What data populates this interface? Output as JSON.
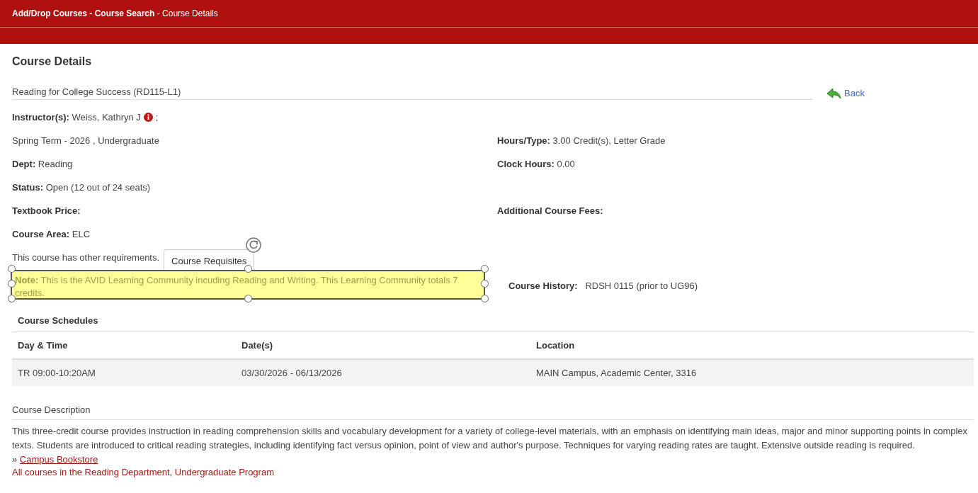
{
  "header": {
    "breadcrumb": "**Add/Drop Courses - Course Search** - Course Details"
  },
  "page_title": "Course Details",
  "course_title": "Reading for College Success (RD115-L1)",
  "back_link": "Back",
  "instructor": {
    "label": "Instructor(s):",
    "value": "Weiss, Kathryn J",
    "suffix": ";"
  },
  "fields": [
    {
      "left": {
        "value": "Spring Term - 2026 , Undergraduate"
      },
      "right": {
        "label": "Hours/Type:",
        "value": "3.00 Credit(s), Letter Grade"
      }
    },
    {
      "left": {
        "label": "Dept:",
        "value": "Reading"
      },
      "right": {
        "label": "Clock Hours:",
        "value": "0.00"
      }
    },
    {
      "left": {
        "label": "Status:",
        "value": "Open (12 out of 24 seats)"
      }
    },
    {
      "left": {
        "label": "Textbook Price:"
      },
      "right": {
        "label": "Additional Course Fees:"
      }
    },
    {
      "left": {
        "label": "Course Area:",
        "value": "ELC"
      }
    }
  ],
  "requirements": {
    "text": "This course has other requirements.",
    "button": "Course Requisites"
  },
  "note": {
    "label": "Note:",
    "text": "This is the AVID Learning Community incuding Reading and Writing. This Learning Community totals 7 credits.",
    "selected": true
  },
  "course_history": {
    "label": "Course History:",
    "value": "RDSH 0115 (prior to UG96)"
  },
  "schedules": {
    "title": "Course Schedules",
    "columns": [
      "Day & Time",
      "Date(s)",
      "Location"
    ],
    "rows": [
      [
        "TR 09:00-10:20AM",
        "03/30/2026 - 06/13/2026",
        "MAIN Campus, Academic Center, 3316"
      ]
    ]
  },
  "description": {
    "heading": "Course Description",
    "text": "This three-credit course provides instruction in reading comprehension skills and vocabulary development for a variety of college-level materials, with an emphasis on identifying main ideas, major and minor supporting points in complex texts. Students are introduced to critical reading strategies, including identifying fact versus opinion, point of view and author's purpose. Techniques for varying reading rates are taught. Extensive outside reading is required.",
    "bookstore_prefix": "»",
    "bookstore_link": "Campus Bookstore",
    "department_link": "All courses in the Reading Department, Undergraduate Program"
  }
}
